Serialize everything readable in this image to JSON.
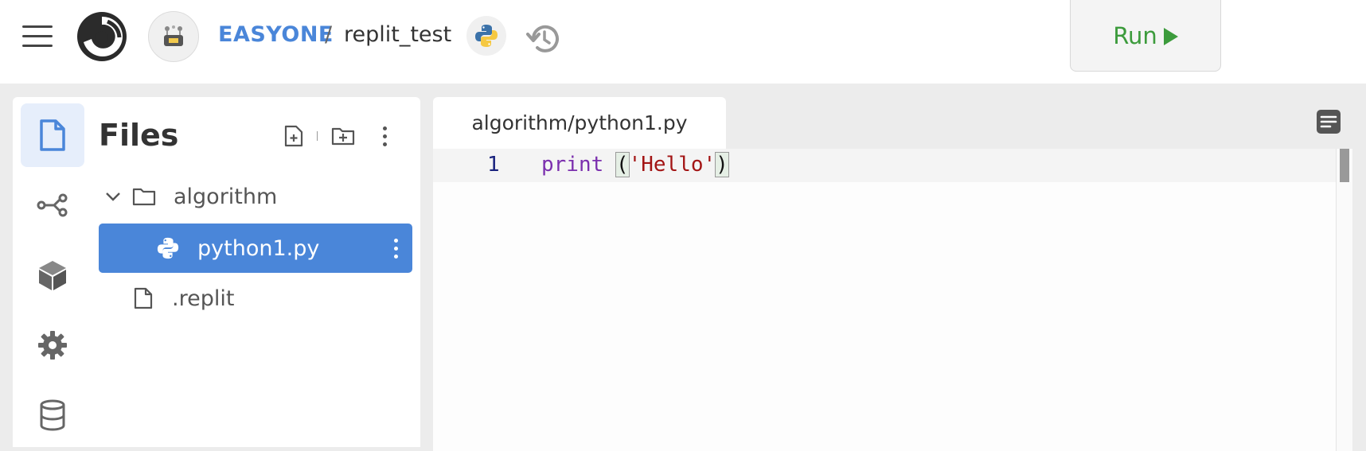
{
  "topbar": {
    "owner": "EASYONE",
    "separator": "/",
    "repl_name": "replit_test",
    "run_label": "Run",
    "run_color": "#3c9b3c",
    "accent_color": "#4a86d9"
  },
  "sidebar": {
    "rail": [
      {
        "icon": "file-icon",
        "active": true
      },
      {
        "icon": "version-control-icon",
        "active": false
      },
      {
        "icon": "packages-icon",
        "active": false
      },
      {
        "icon": "settings-gear-icon",
        "active": false
      },
      {
        "icon": "database-icon",
        "active": false
      }
    ]
  },
  "files": {
    "title": "Files",
    "actions": [
      "new-file-icon",
      "new-folder-icon",
      "more-options-icon"
    ],
    "tree": [
      {
        "name": "algorithm",
        "type": "folder",
        "expanded": true
      },
      {
        "name": "python1.py",
        "type": "python-file",
        "selected": true
      },
      {
        "name": ".replit",
        "type": "file"
      }
    ]
  },
  "editor": {
    "tab_label": "algorithm/python1.py",
    "lines": [
      {
        "number": "1",
        "keyword": "print",
        "space": " ",
        "open": "(",
        "string": "'Hello'",
        "close": ")"
      }
    ]
  }
}
